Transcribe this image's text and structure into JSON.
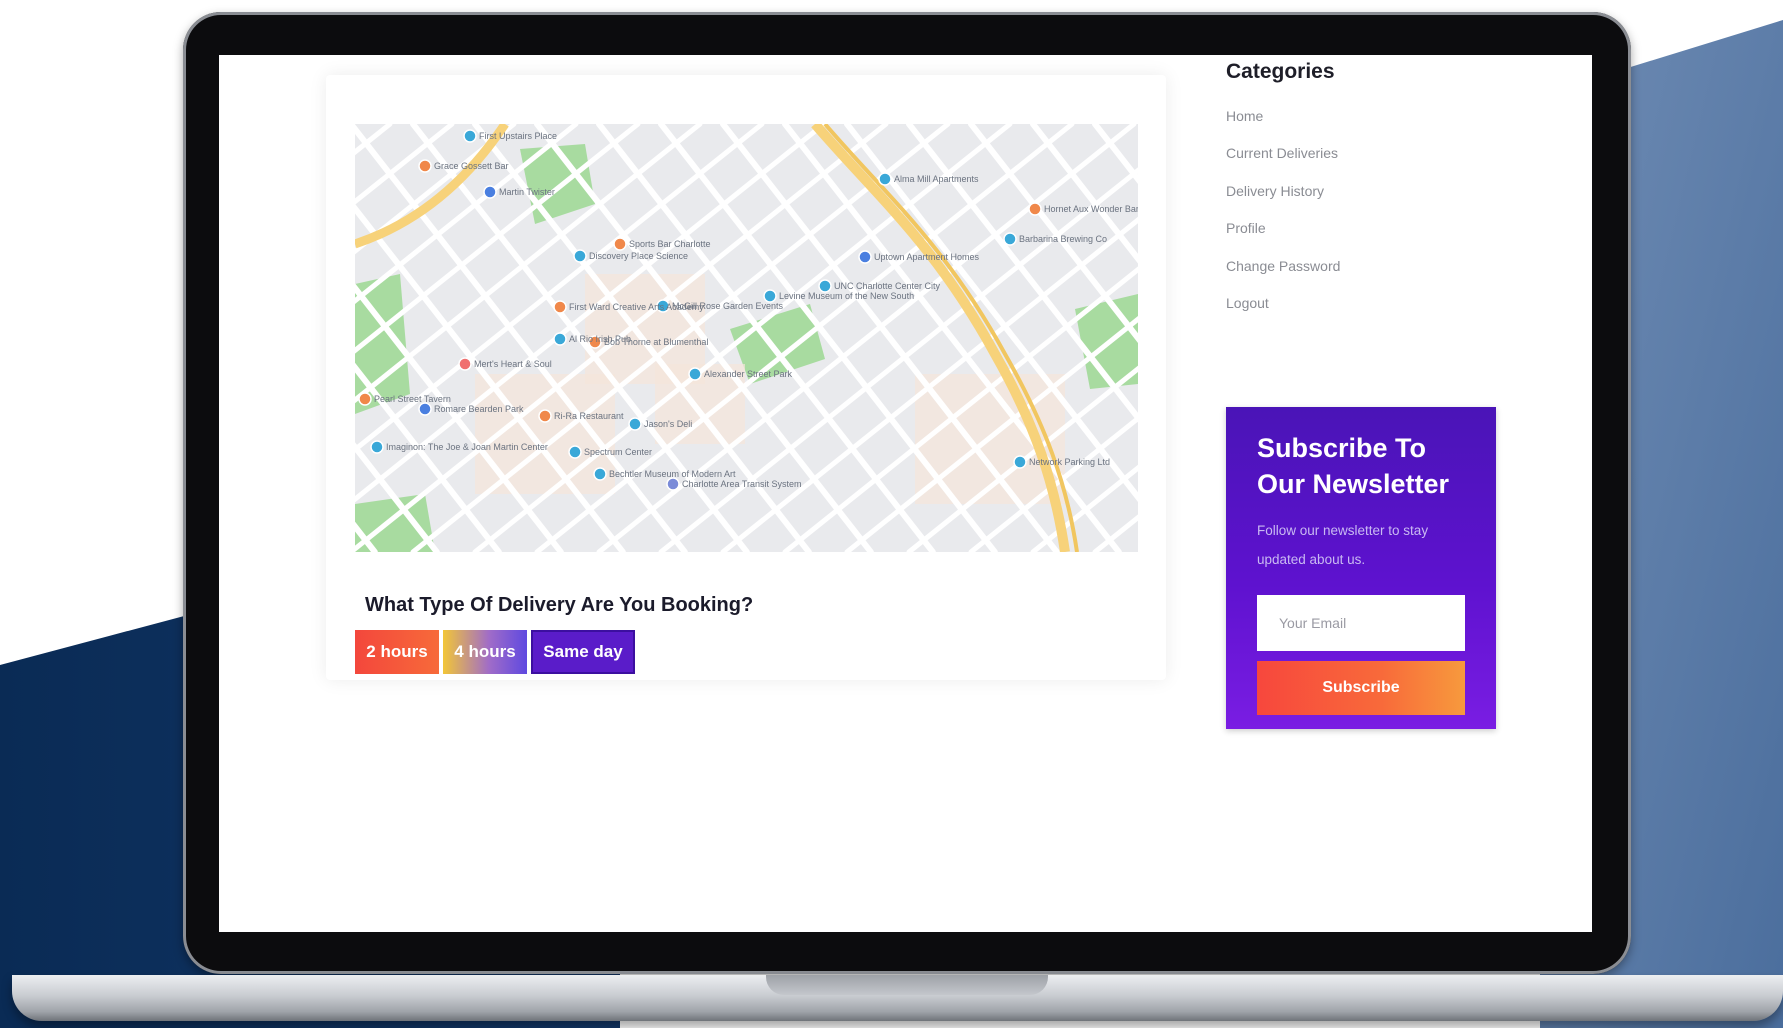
{
  "map": {
    "places": [
      "First Upstairs Place",
      "Grace Gossett Bar",
      "Martin Twister",
      "Sports Bar Charlotte",
      "Discovery Place Science",
      "Alma Mill Apartments",
      "Hornet Aux Wonder Bar",
      "Barbarina Brewing Co",
      "McGill Rose Garden Events",
      "Levine Museum of the New South",
      "UNC Charlotte Center City",
      "First Ward Creative Arts Academy",
      "Al Rio Irish Pub",
      "Bob Thorne at Blumenthal",
      "Mert's Heart & Soul",
      "Pearl Street Tavern",
      "Romare Bearden Park",
      "Ri-Ra Restaurant",
      "Jason's Deli",
      "Imaginon: The Joe & Joan Martin Center",
      "Spectrum Center",
      "Bechtler Museum of Modern Art",
      "Charlotte Area Transit System",
      "Network Parking Ltd",
      "Alexander Street Park",
      "Uptown Apartment Homes"
    ]
  },
  "delivery": {
    "title": "What Type Of Delivery Are You Booking?",
    "options": [
      "2 hours",
      "4 hours",
      "Same day"
    ]
  },
  "sidebar": {
    "title": "Categories",
    "items": [
      "Home",
      "Current Deliveries",
      "Delivery History",
      "Profile",
      "Change Password",
      "Logout"
    ]
  },
  "newsletter": {
    "title": "Subscribe To Our Newsletter",
    "text": "Follow our newsletter to stay updated about us.",
    "email_placeholder": "Your Email",
    "button_label": "Subscribe"
  },
  "colors": {
    "accent_purple": "#5a1cc9",
    "accent_orange": "#f7473d",
    "bg_navy": "#0b2f5c"
  }
}
